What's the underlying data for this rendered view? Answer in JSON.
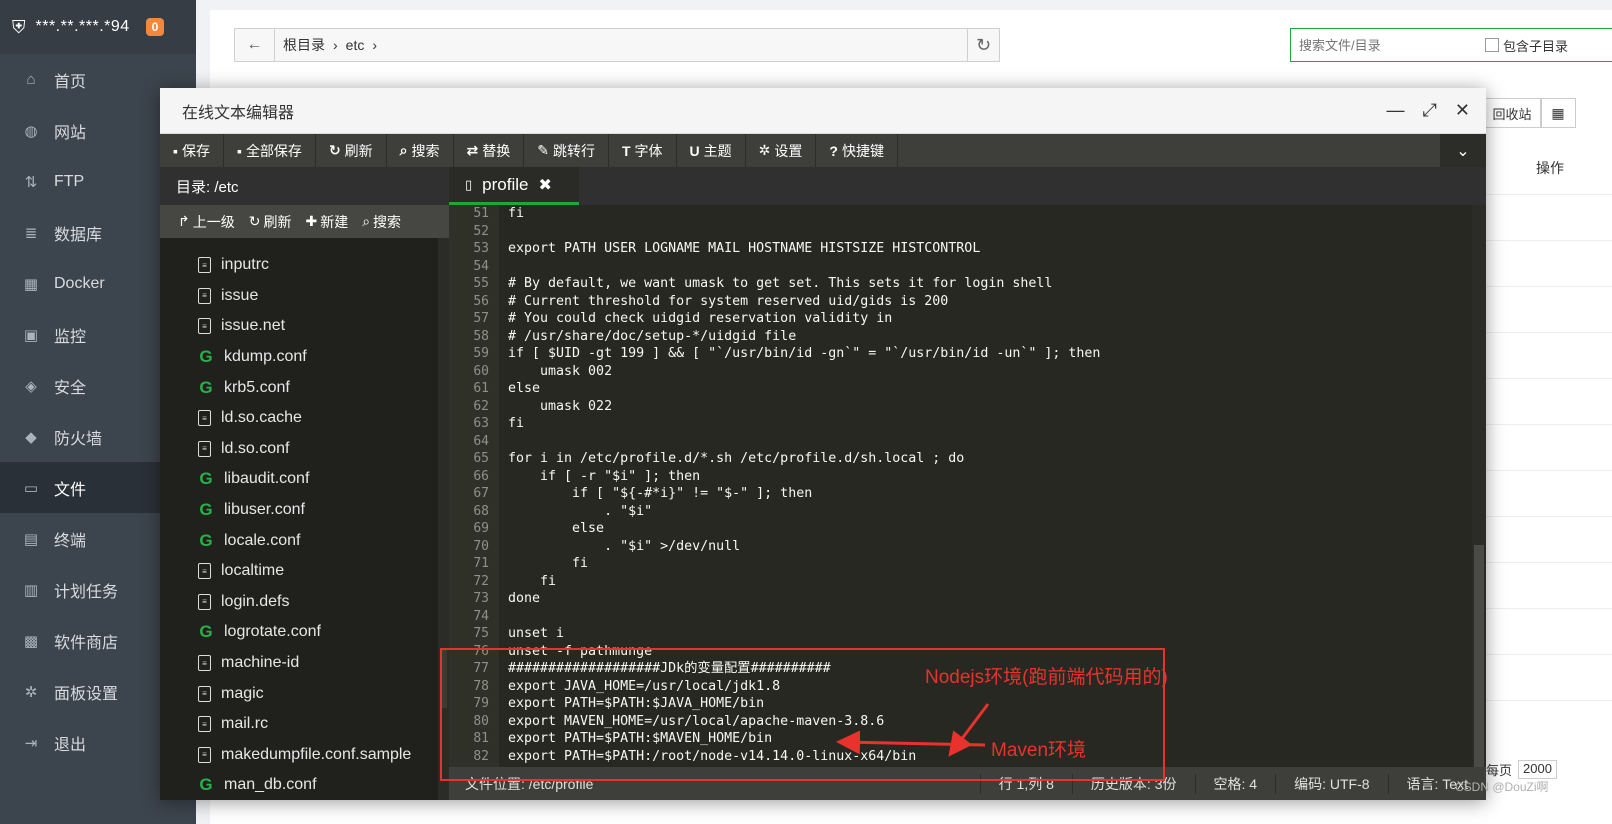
{
  "sidebar": {
    "ip": "***.**.***.*94",
    "badge": "0",
    "items": [
      {
        "label": "首页",
        "icon": "home-icon",
        "glyph": "⌂"
      },
      {
        "label": "网站",
        "icon": "globe-icon",
        "glyph": "◍"
      },
      {
        "label": "FTP",
        "icon": "ftp-icon",
        "glyph": "⇅"
      },
      {
        "label": "数据库",
        "icon": "database-icon",
        "glyph": "≣"
      },
      {
        "label": "Docker",
        "icon": "docker-icon",
        "glyph": "▦"
      },
      {
        "label": "监控",
        "icon": "monitor-icon",
        "glyph": "▣"
      },
      {
        "label": "安全",
        "icon": "shield-icon",
        "glyph": "◈"
      },
      {
        "label": "防火墙",
        "icon": "firewall-icon",
        "glyph": "◆"
      },
      {
        "label": "文件",
        "icon": "folder-icon",
        "glyph": "▭",
        "active": true
      },
      {
        "label": "终端",
        "icon": "terminal-icon",
        "glyph": "▤"
      },
      {
        "label": "计划任务",
        "icon": "calendar-icon",
        "glyph": "▥"
      },
      {
        "label": "软件商店",
        "icon": "apps-icon",
        "glyph": "▩"
      },
      {
        "label": "面板设置",
        "icon": "gear-icon",
        "glyph": "✲"
      },
      {
        "label": "退出",
        "icon": "logout-icon",
        "glyph": "⇥"
      }
    ]
  },
  "background": {
    "crumbs": [
      "根目录",
      "etc"
    ],
    "search_placeholder": "搜索文件/目录",
    "include_subdir": "包含子目录",
    "recycle": "回收站",
    "ops_header": "操作",
    "per_page_label": "每页",
    "per_page_value": "2000"
  },
  "editor": {
    "title": "在线文本编辑器",
    "toolbar": [
      {
        "label": "保存",
        "icon": "save-icon",
        "glyph": "▪"
      },
      {
        "label": "全部保存",
        "icon": "save-all-icon",
        "glyph": "▪"
      },
      {
        "label": "刷新",
        "icon": "refresh-icon",
        "glyph": "↻"
      },
      {
        "label": "搜索",
        "icon": "search-icon",
        "glyph": "⌕"
      },
      {
        "label": "替换",
        "icon": "replace-icon",
        "glyph": "⇄"
      },
      {
        "label": "跳转行",
        "icon": "goto-line-icon",
        "glyph": "✎"
      },
      {
        "label": "字体",
        "icon": "font-icon",
        "glyph": "T"
      },
      {
        "label": "主题",
        "icon": "theme-icon",
        "glyph": "U"
      },
      {
        "label": "设置",
        "icon": "settings-icon",
        "glyph": "✲"
      },
      {
        "label": "快捷键",
        "icon": "help-icon",
        "glyph": "?"
      }
    ],
    "dir_label": "目录: /etc",
    "dir_actions": [
      {
        "label": "上一级",
        "icon": "up-level-icon",
        "glyph": "↱"
      },
      {
        "label": "刷新",
        "icon": "refresh-icon",
        "glyph": "↻"
      },
      {
        "label": "新建",
        "icon": "plus-icon",
        "glyph": "✚"
      },
      {
        "label": "搜索",
        "icon": "search-icon",
        "glyph": "⌕"
      }
    ],
    "files": [
      {
        "name": "inputrc",
        "type": "doc"
      },
      {
        "name": "issue",
        "type": "doc"
      },
      {
        "name": "issue.net",
        "type": "doc"
      },
      {
        "name": "kdump.conf",
        "type": "conf"
      },
      {
        "name": "krb5.conf",
        "type": "conf"
      },
      {
        "name": "ld.so.cache",
        "type": "doc"
      },
      {
        "name": "ld.so.conf",
        "type": "doc"
      },
      {
        "name": "libaudit.conf",
        "type": "conf"
      },
      {
        "name": "libuser.conf",
        "type": "conf"
      },
      {
        "name": "locale.conf",
        "type": "conf"
      },
      {
        "name": "localtime",
        "type": "doc"
      },
      {
        "name": "login.defs",
        "type": "doc"
      },
      {
        "name": "logrotate.conf",
        "type": "conf"
      },
      {
        "name": "machine-id",
        "type": "doc"
      },
      {
        "name": "magic",
        "type": "doc"
      },
      {
        "name": "mail.rc",
        "type": "doc"
      },
      {
        "name": "makedumpfile.conf.sample",
        "type": "doc"
      },
      {
        "name": "man_db.conf",
        "type": "conf"
      }
    ],
    "tab_name": "profile",
    "code_lines": [
      {
        "n": "51",
        "t": "fi"
      },
      {
        "n": "52",
        "t": ""
      },
      {
        "n": "53",
        "t": "export PATH USER LOGNAME MAIL HOSTNAME HISTSIZE HISTCONTROL"
      },
      {
        "n": "54",
        "t": ""
      },
      {
        "n": "55",
        "t": "# By default, we want umask to get set. This sets it for login shell"
      },
      {
        "n": "56",
        "t": "# Current threshold for system reserved uid/gids is 200"
      },
      {
        "n": "57",
        "t": "# You could check uidgid reservation validity in"
      },
      {
        "n": "58",
        "t": "# /usr/share/doc/setup-*/uidgid file"
      },
      {
        "n": "59",
        "t": "if [ $UID -gt 199 ] && [ \"`/usr/bin/id -gn`\" = \"`/usr/bin/id -un`\" ]; then"
      },
      {
        "n": "60",
        "t": "    umask 002"
      },
      {
        "n": "61",
        "t": "else"
      },
      {
        "n": "62",
        "t": "    umask 022"
      },
      {
        "n": "63",
        "t": "fi"
      },
      {
        "n": "64",
        "t": ""
      },
      {
        "n": "65",
        "t": "for i in /etc/profile.d/*.sh /etc/profile.d/sh.local ; do"
      },
      {
        "n": "66",
        "t": "    if [ -r \"$i\" ]; then"
      },
      {
        "n": "67",
        "t": "        if [ \"${-#*i}\" != \"$-\" ]; then"
      },
      {
        "n": "68",
        "t": "            . \"$i\""
      },
      {
        "n": "69",
        "t": "        else"
      },
      {
        "n": "70",
        "t": "            . \"$i\" >/dev/null"
      },
      {
        "n": "71",
        "t": "        fi"
      },
      {
        "n": "72",
        "t": "    fi"
      },
      {
        "n": "73",
        "t": "done"
      },
      {
        "n": "74",
        "t": ""
      },
      {
        "n": "75",
        "t": "unset i"
      },
      {
        "n": "76",
        "t": "unset -f pathmunge"
      },
      {
        "n": "77",
        "t": "###################JDk的变量配置##########"
      },
      {
        "n": "78",
        "t": "export JAVA_HOME=/usr/local/jdk1.8"
      },
      {
        "n": "79",
        "t": "export PATH=$PATH:$JAVA_HOME/bin"
      },
      {
        "n": "80",
        "t": "export MAVEN_HOME=/usr/local/apache-maven-3.8.6"
      },
      {
        "n": "81",
        "t": "export PATH=$PATH:$MAVEN_HOME/bin"
      },
      {
        "n": "82",
        "t": "export PATH=$PATH:/root/node-v14.14.0-linux-x64/bin"
      }
    ],
    "status": {
      "location": "文件位置: /etc/profile",
      "cursor": "行 1,列 8",
      "history": "历史版本: 3份",
      "spaces": "空格: 4",
      "encoding": "编码: UTF-8",
      "language": "语言: Text"
    }
  },
  "annotations": {
    "node_label": "Nodejs环境(跑前端代码用的)",
    "maven_label": "Maven环境"
  },
  "watermark": "CSDN @DouZi啊",
  "colors": {
    "accent_green": "#20a53a",
    "annotation_red": "#e8332c"
  }
}
